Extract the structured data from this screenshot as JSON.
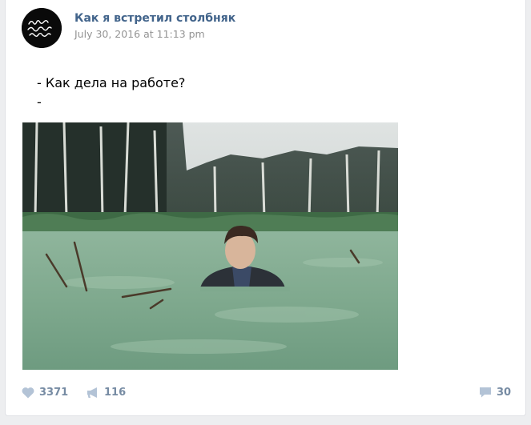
{
  "post": {
    "author": "Как я встретил столбняк",
    "date": "July 30, 2016 at 11:13 pm",
    "avatar_logo_text": "Как я встретил столбняк",
    "text_lines": [
      "- Как дела на работе?",
      "-"
    ],
    "photo_icon": "photo-boy-in-swamp"
  },
  "actions": {
    "likes": "3371",
    "like_icon": "heart-icon",
    "shares": "116",
    "share_icon": "megaphone-icon",
    "comments": "30",
    "comment_icon": "comment-icon"
  },
  "colors": {
    "link": "#42648b",
    "muted": "#939393",
    "action": "#768ba3",
    "icon": "#b3c3d6"
  }
}
